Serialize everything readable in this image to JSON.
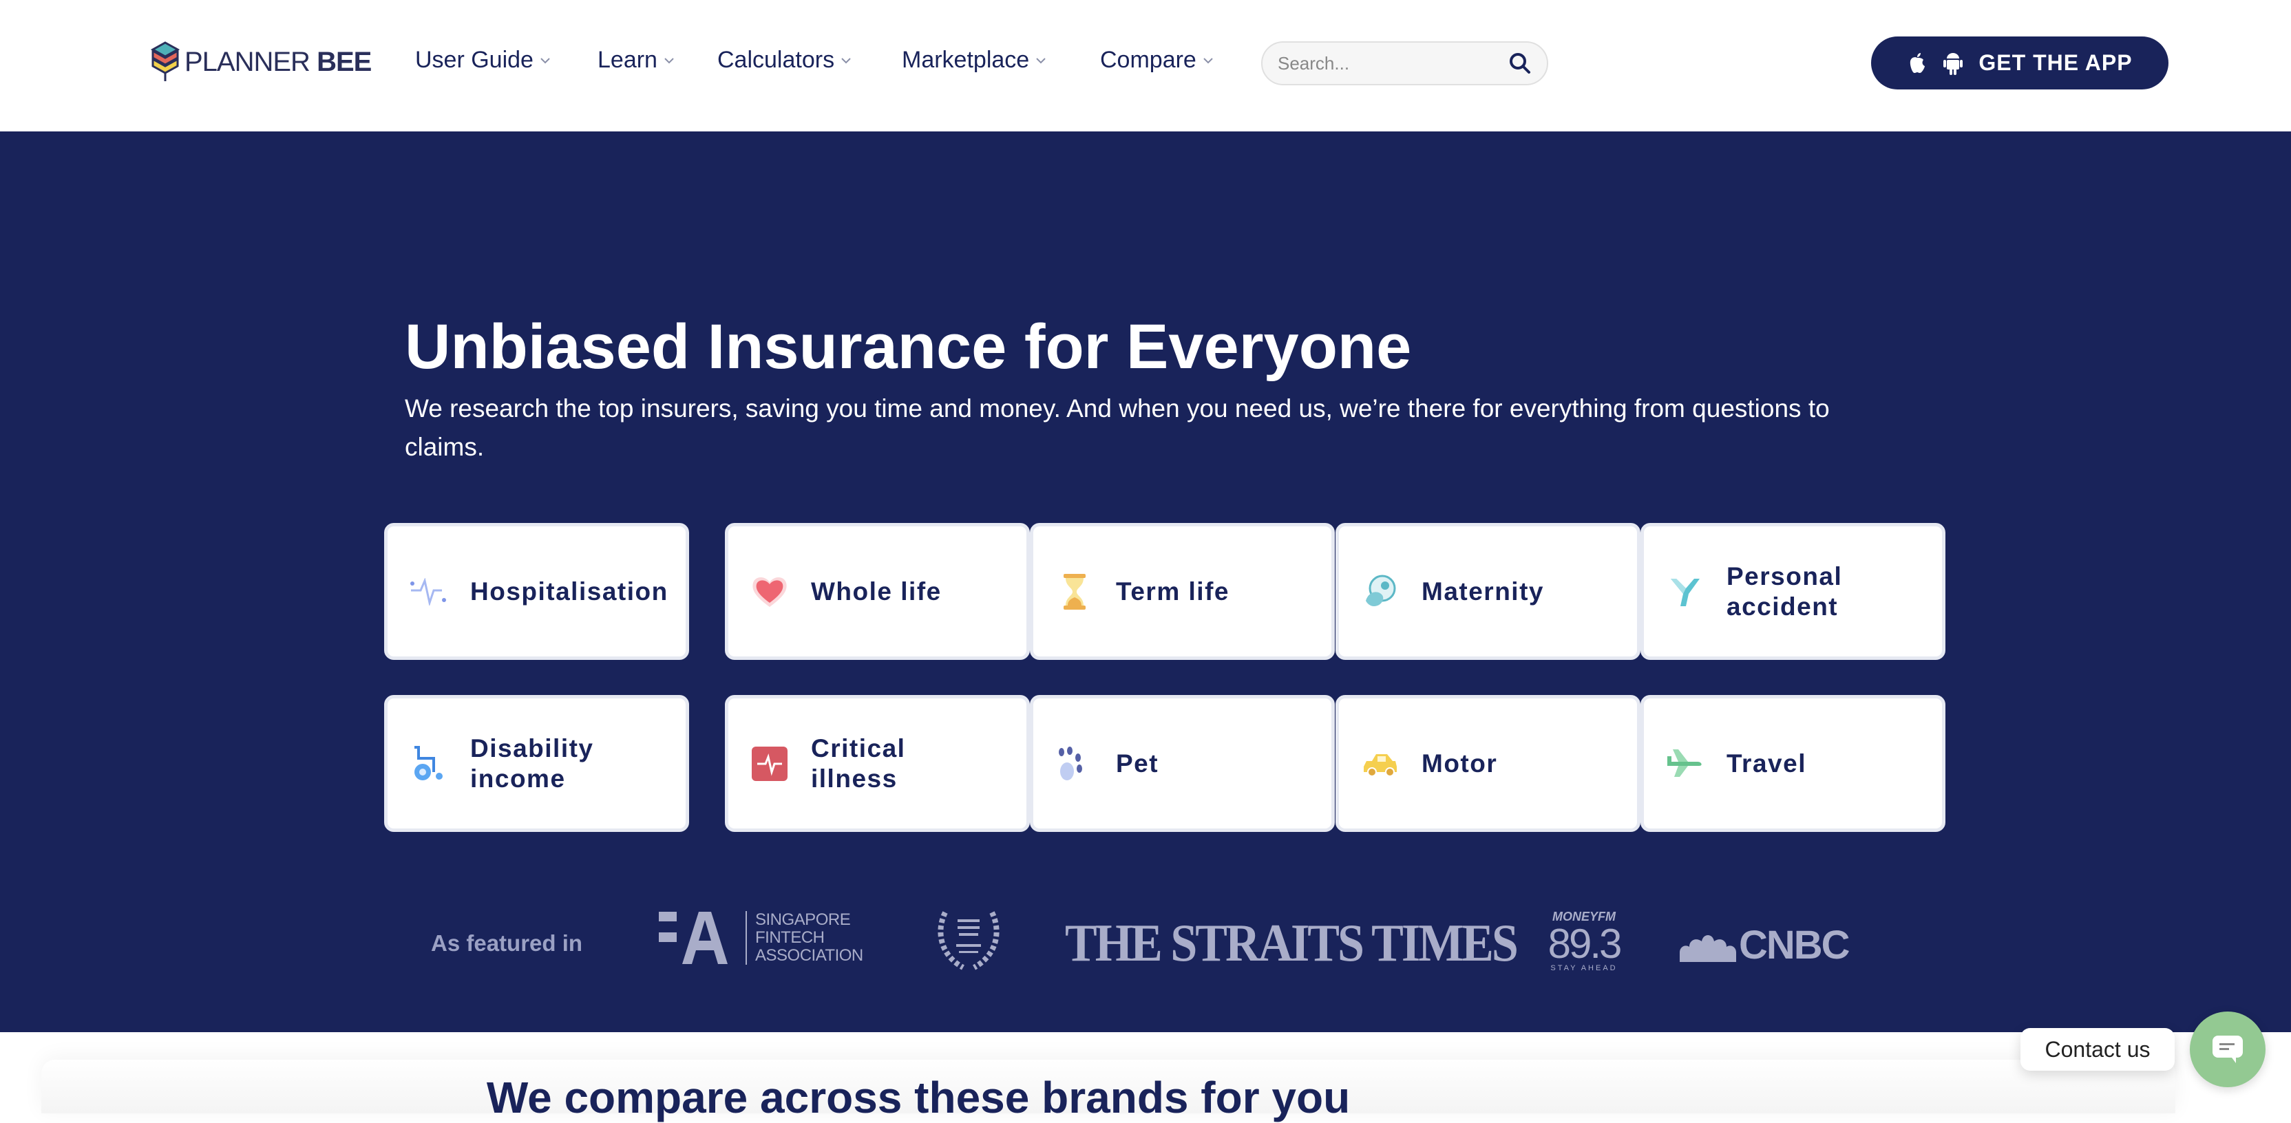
{
  "header": {
    "logo": {
      "part1": "PLANNER",
      "part2": "BEE"
    },
    "nav": [
      {
        "label": "User Guide"
      },
      {
        "label": "Learn"
      },
      {
        "label": "Calculators"
      },
      {
        "label": "Marketplace"
      },
      {
        "label": "Compare"
      }
    ],
    "search": {
      "placeholder": "Search...",
      "value": "",
      "icon": "search-icon"
    },
    "app_button": {
      "label": "GET THE APP",
      "icons": [
        "apple-icon",
        "android-icon"
      ]
    }
  },
  "hero": {
    "title": "Unbiased Insurance for Everyone",
    "subtitle": "We research the top insurers, saving you time and money. And when you need us, we’re there for everything from questions to claims.",
    "categories": [
      {
        "label": "Hospitalisation",
        "icon": "heartbeat-icon"
      },
      {
        "label": "Whole life",
        "icon": "heart-icon"
      },
      {
        "label": "Term life",
        "icon": "hourglass-icon"
      },
      {
        "label": "Maternity",
        "icon": "baby-icon"
      },
      {
        "label": "Personal accident",
        "icon": "accident-icon"
      },
      {
        "label": "Disability income",
        "icon": "wheelchair-icon"
      },
      {
        "label": "Critical illness",
        "icon": "medical-pulse-icon"
      },
      {
        "label": "Pet",
        "icon": "paw-icon"
      },
      {
        "label": "Motor",
        "icon": "car-icon"
      },
      {
        "label": "Travel",
        "icon": "plane-icon"
      }
    ],
    "featured": {
      "label": "As featured in",
      "logos": [
        {
          "name": "Singapore Fintech Association",
          "text": [
            "SINGAPORE",
            "FINTECH",
            "ASSOCIATION"
          ]
        },
        {
          "name": "Excellence in Finance Leaders Awards"
        },
        {
          "name": "The Straits Times",
          "text": "THE STRAITS TIMES"
        },
        {
          "name": "MoneyFM 89.3",
          "text": [
            "MONEYFM",
            "89.3",
            "STAY AHEAD"
          ]
        },
        {
          "name": "CNBC",
          "text": "CNBC"
        }
      ]
    },
    "colors": {
      "background": "#19235a",
      "card_border": "#e6e9f2",
      "logo_gray": "#a9adc9"
    }
  },
  "brands": {
    "title": "We compare across these brands for you"
  },
  "contact": {
    "label": "Contact us",
    "color": "#93c992"
  }
}
